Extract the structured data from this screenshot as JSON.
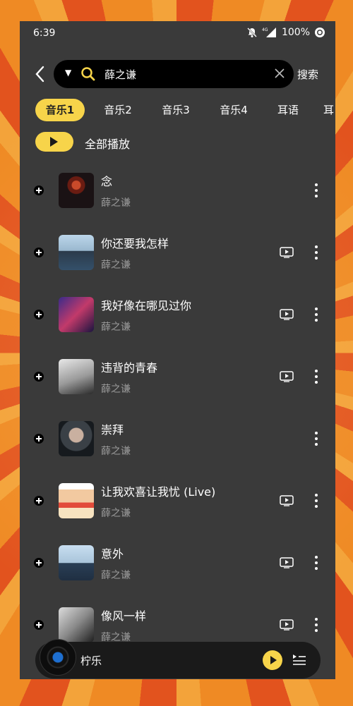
{
  "status": {
    "time": "6:39",
    "battery": "100%",
    "network": "4G"
  },
  "search": {
    "query": "薛之谦",
    "button": "搜索"
  },
  "tabs": [
    "音乐1",
    "音乐2",
    "音乐3",
    "音乐4",
    "耳语",
    "耳"
  ],
  "play_all": "全部播放",
  "songs": [
    {
      "title": "念",
      "artist": "薛之谦",
      "has_mv": false,
      "cover": "c1"
    },
    {
      "title": "你还要我怎样",
      "artist": "薛之谦",
      "has_mv": true,
      "cover": "c2"
    },
    {
      "title": "我好像在哪见过你",
      "artist": "薛之谦",
      "has_mv": true,
      "cover": "c3"
    },
    {
      "title": "违背的青春",
      "artist": "薛之谦",
      "has_mv": true,
      "cover": "c4"
    },
    {
      "title": "崇拜",
      "artist": "薛之谦",
      "has_mv": false,
      "cover": "c5"
    },
    {
      "title": "让我欢喜让我忧 (Live)",
      "artist": "薛之谦",
      "has_mv": true,
      "cover": "c6"
    },
    {
      "title": "意外",
      "artist": "薛之谦",
      "has_mv": true,
      "cover": "c7"
    },
    {
      "title": "像风一样",
      "artist": "薛之谦",
      "has_mv": true,
      "cover": "c8"
    }
  ],
  "player": {
    "title": "柠乐"
  },
  "colors": {
    "accent": "#f7d44a",
    "panel": "#3a3a3a"
  }
}
